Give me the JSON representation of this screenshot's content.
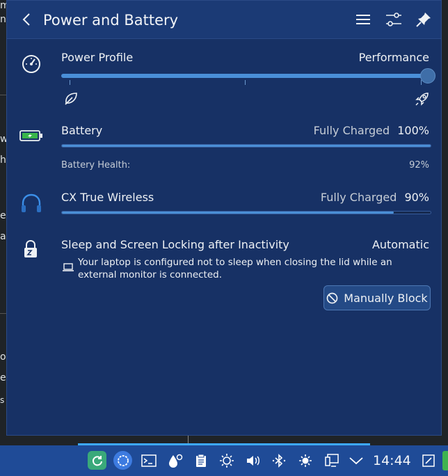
{
  "header": {
    "title": "Power and Battery"
  },
  "power_profile": {
    "label": "Power Profile",
    "value": "Performance",
    "level_percent": 100,
    "ticks": [
      "power-save",
      "balanced",
      "performance"
    ]
  },
  "battery": {
    "label": "Battery",
    "status": "Fully Charged",
    "percent_text": "100%",
    "level_percent": 100,
    "health_label": "Battery Health:",
    "health_value": "92%"
  },
  "device": {
    "label": "CX True Wireless",
    "status": "Fully Charged",
    "percent_text": "90%",
    "level_percent": 90
  },
  "inhibition": {
    "label": "Sleep and Screen Locking after Inactivity",
    "value": "Automatic",
    "message": "Your laptop is configured not to sleep when closing the lid while an external monitor is connected.",
    "button": "Manually Block"
  },
  "taskbar": {
    "clock": "14:44"
  },
  "colors": {
    "panel": "#173165",
    "accent": "#4b8fd6",
    "taskbar": "#1f4b97"
  }
}
